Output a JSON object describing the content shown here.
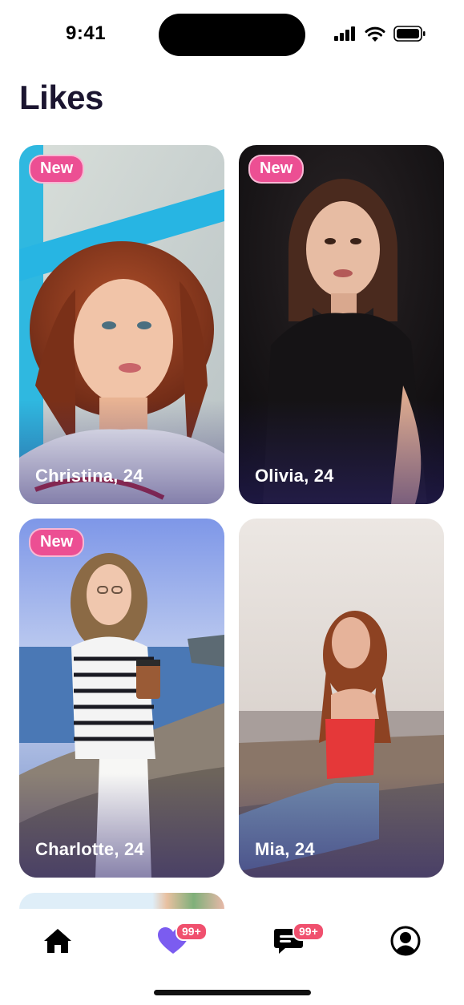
{
  "status": {
    "time": "9:41"
  },
  "page": {
    "title": "Likes"
  },
  "cards": [
    {
      "name": "Christina, 24",
      "badge": "New"
    },
    {
      "name": "Olivia, 24",
      "badge": "New"
    },
    {
      "name": "Charlotte, 24",
      "badge": "New"
    },
    {
      "name": "Mia, 24",
      "badge": ""
    }
  ],
  "tabs": [
    {
      "icon": "home-icon"
    },
    {
      "icon": "heart-icon",
      "badge": "99+"
    },
    {
      "icon": "chat-icon",
      "badge": "99+"
    },
    {
      "icon": "profile-icon"
    }
  ],
  "colors": {
    "accent": "#7b5cf0",
    "badge": "#ec4f93",
    "notification": "#f0506e",
    "title": "#1b1530"
  }
}
